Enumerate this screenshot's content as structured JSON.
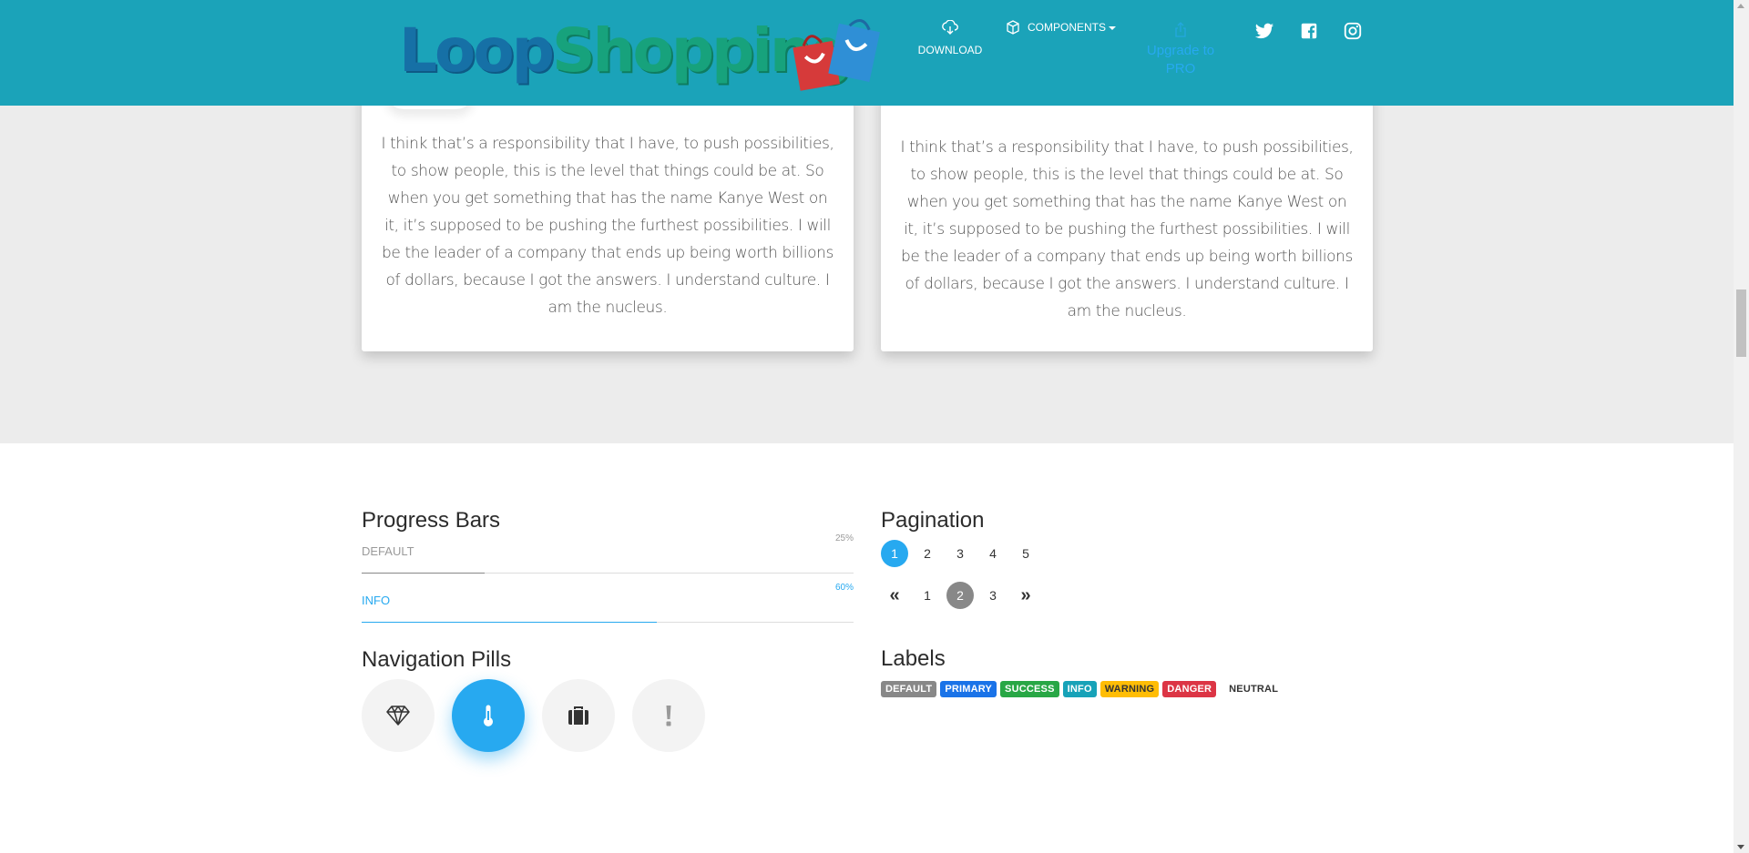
{
  "navbar": {
    "brand": {
      "part1": "Loop",
      "part2": "Shopping"
    },
    "download_label": "DOWNLOAD",
    "components_label": "COMPONENTS",
    "upgrade_label": "Upgrade to PRO",
    "icons": [
      "cloud-download-icon",
      "cube-icon",
      "share-icon",
      "twitter-icon",
      "facebook-icon",
      "instagram-icon"
    ]
  },
  "cards": [
    {
      "quote": "I think that’s a responsibility that I have, to push possibilities, to show people, this is the level that things could be at. So when you get something that has the name Kanye West on it, it’s supposed to be pushing the furthest possibilities. I will be the leader of a company that ends up being worth billions of dollars, because I got the answers. I understand culture. I am the nucleus."
    },
    {
      "quote": "I think that’s a responsibility that I have, to push possibilities, to show people, this is the level that things could be at. So when you get something that has the name Kanye West on it, it’s supposed to be pushing the furthest possibilities. I will be the leader of a company that ends up being worth billions of dollars, because I got the answers. I understand culture. I am the nucleus."
    }
  ],
  "progress": {
    "title": "Progress Bars",
    "bars": [
      {
        "label": "DEFAULT",
        "value_text": "25%",
        "value": 25
      },
      {
        "label": "INFO",
        "value_text": "60%",
        "value": 60
      }
    ]
  },
  "navigation_pills": {
    "title": "Navigation Pills",
    "items": [
      {
        "icon": "diamond-icon",
        "active": false
      },
      {
        "icon": "thermometer-icon",
        "active": true
      },
      {
        "icon": "briefcase-icon",
        "active": false
      },
      {
        "icon": "exclamation-icon",
        "active": false
      }
    ]
  },
  "pagination": {
    "title": "Pagination",
    "pager1": [
      "1",
      "2",
      "3",
      "4",
      "5"
    ],
    "pager1_active": "1",
    "pager2": [
      "1",
      "2",
      "3"
    ],
    "pager2_active": "2",
    "prev_symbol": "«",
    "next_symbol": "»"
  },
  "labels": {
    "title": "Labels",
    "items": [
      {
        "text": "DEFAULT",
        "color": "#888888"
      },
      {
        "text": "PRIMARY",
        "color": "#1a73e8"
      },
      {
        "text": "SUCCESS",
        "color": "#28a745"
      },
      {
        "text": "INFO",
        "color": "#17a2b8"
      },
      {
        "text": "WARNING",
        "color": "#ffbd05"
      },
      {
        "text": "DANGER",
        "color": "#dc3545"
      },
      {
        "text": "NEUTRAL",
        "color": "transparent"
      }
    ]
  },
  "colors": {
    "navbar": "#1ba3b9",
    "accent": "#27a9f0",
    "section_grey": "#ececec"
  }
}
